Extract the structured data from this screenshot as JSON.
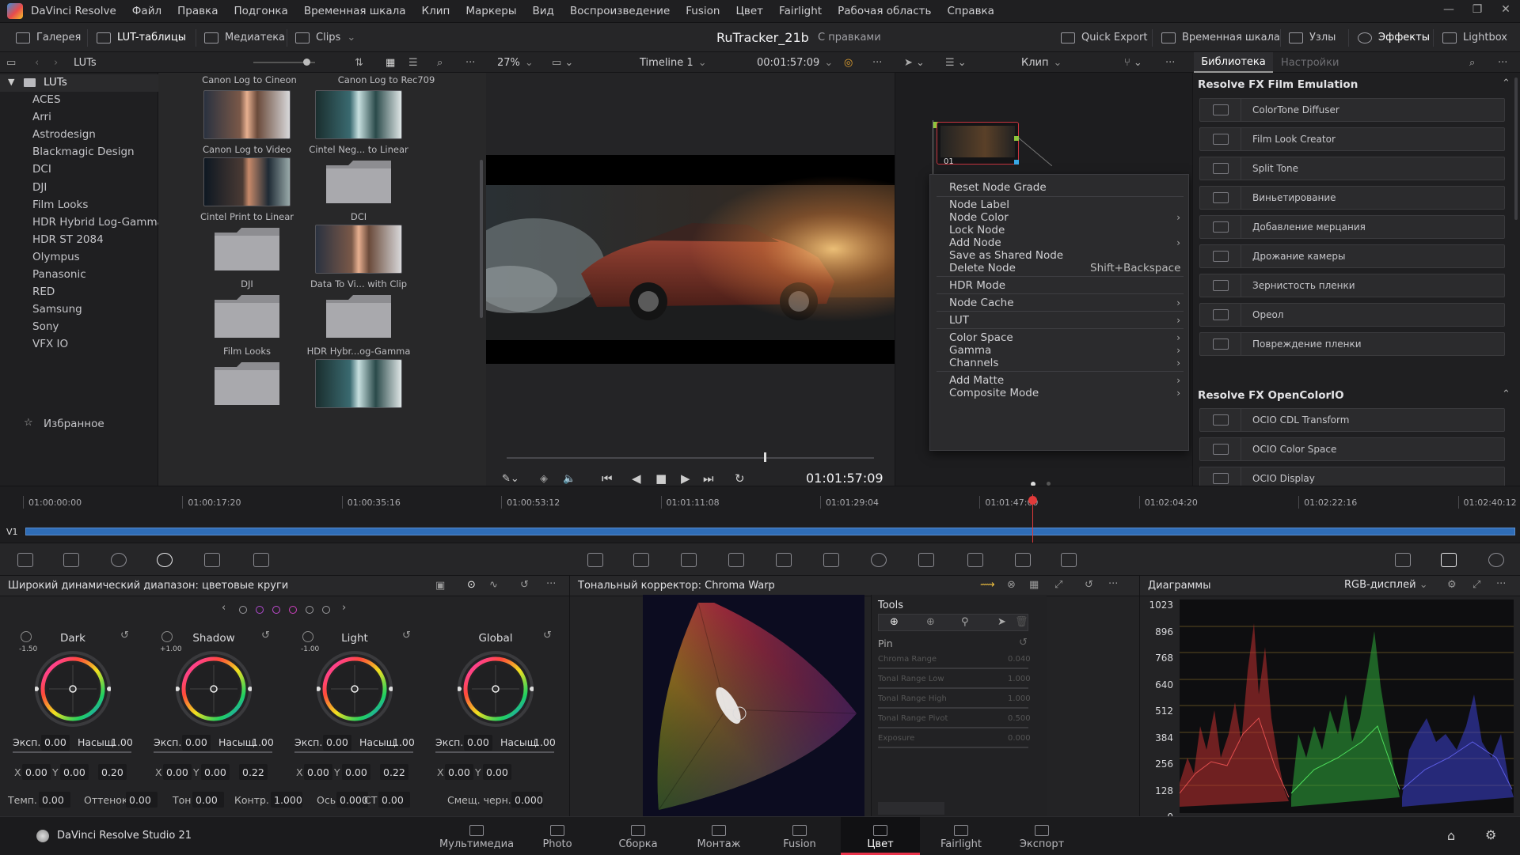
{
  "menubar": {
    "app": "DaVinci Resolve",
    "items": [
      "Файл",
      "Правка",
      "Подгонка",
      "Временная шкала",
      "Клип",
      "Маркеры",
      "Вид",
      "Воспроизведение",
      "Fusion",
      "Цвет",
      "Fairlight",
      "Рабочая область",
      "Справка"
    ]
  },
  "toolbar": {
    "gallery": "Галерея",
    "luts": "LUT-таблицы",
    "media": "Медиатека",
    "clips": "Clips",
    "project": "RuTracker_21b",
    "project_status": "С правками",
    "quick_export": "Quick Export",
    "timeline": "Временная шкала",
    "nodes": "Узлы",
    "effects": "Эффекты",
    "lightbox": "Lightbox"
  },
  "header": {
    "luts_title": "LUTs",
    "zoom": "27%",
    "timeline_name": "Timeline 1",
    "timecode": "00:01:57:09",
    "clip_mode": "Клип",
    "tab_library": "Библиотека",
    "tab_settings": "Настройки"
  },
  "tree": {
    "root": "LUTs",
    "items": [
      "ACES",
      "Arri",
      "Astrodesign",
      "Blackmagic Design",
      "DCI",
      "DJI",
      "Film Looks",
      "HDR Hybrid Log-Gamma",
      "HDR ST 2084",
      "Olympus",
      "Panasonic",
      "RED",
      "Samsung",
      "Sony",
      "VFX IO"
    ],
    "favorites": "Избранное"
  },
  "thumbs": {
    "top_labels": [
      "Canon Log to Cineon",
      "Canon Log to Rec709"
    ],
    "items": [
      {
        "label": "Canon Log to Video",
        "type": "face"
      },
      {
        "label": "Cintel Neg... to Linear",
        "type": "neg"
      },
      {
        "label": "Cintel Print to Linear",
        "type": "dark"
      },
      {
        "label": "DCI",
        "type": "folder"
      },
      {
        "label": "DJI",
        "type": "folder"
      },
      {
        "label": "Data To Vi... with Clip",
        "type": "face"
      },
      {
        "label": "Film Looks",
        "type": "folder"
      },
      {
        "label": "HDR Hybr...og-Gamma",
        "type": "folder"
      },
      {
        "label": "",
        "type": "folder"
      },
      {
        "label": "",
        "type": "neg"
      }
    ]
  },
  "viewer": {
    "timecode": "01:01:57:09",
    "scrub_position": 0.7
  },
  "node": {
    "label": "01"
  },
  "context_menu": {
    "items": [
      {
        "label": "Reset Node Grade"
      },
      {
        "label": "Node Label"
      },
      {
        "label": "Node Color",
        "sub": true
      },
      {
        "label": "Lock Node"
      },
      {
        "label": "Add Node",
        "sub": true
      },
      {
        "label": "Save as Shared Node"
      },
      {
        "label": "Delete Node",
        "shortcut": "Shift+Backspace"
      },
      {
        "label": "HDR Mode"
      },
      {
        "label": "Node Cache",
        "sub": true
      },
      {
        "label": "LUT",
        "sub": true
      },
      {
        "label": "Color Space",
        "sub": true
      },
      {
        "label": "Gamma",
        "sub": true
      },
      {
        "label": "Channels",
        "sub": true
      },
      {
        "label": "Add Matte",
        "sub": true
      },
      {
        "label": "Composite Mode",
        "sub": true
      }
    ]
  },
  "effects": {
    "section1": "Resolve FX Film Emulation",
    "items1": [
      "ColorTone Diffuser",
      "Film Look Creator",
      "Split Tone",
      "Виньетирование",
      "Добавление мерцания",
      "Дрожание камеры",
      "Зернистость пленки",
      "Ореол",
      "Повреждение пленки"
    ],
    "section2": "Resolve FX OpenColorIO",
    "items2": [
      "OCIO CDL Transform",
      "OCIO Color Space",
      "OCIO Display"
    ]
  },
  "timeline": {
    "track": "V1",
    "timecodes": [
      "01:00:00:00",
      "01:00:17:20",
      "01:00:35:16",
      "01:00:53:12",
      "01:01:11:08",
      "01:01:29:04",
      "01:01:47:00",
      "01:02:04:20",
      "01:02:22:16",
      "01:02:40:12"
    ],
    "playhead_position": 0.703
  },
  "wheels": {
    "title": "Широкий динамический диапазон: цветовые круги",
    "wheels": [
      {
        "name": "Dark",
        "exp_label": "Эксп.",
        "exp": "0.00",
        "sat_label": "Насыщ.",
        "sat": "1.00",
        "x": "0.00",
        "y": "0.00",
        "z": "0.20",
        "corner": "-1.50"
      },
      {
        "name": "Shadow",
        "exp_label": "Эксп.",
        "exp": "0.00",
        "sat_label": "Насыщ.",
        "sat": "1.00",
        "x": "0.00",
        "y": "0.00",
        "z": "0.22",
        "corner": "+1.00"
      },
      {
        "name": "Light",
        "exp_label": "Эксп.",
        "exp": "0.00",
        "sat_label": "Насыщ.",
        "sat": "1.00",
        "x": "0.00",
        "y": "0.00",
        "z": "0.22",
        "corner": "-1.00"
      },
      {
        "name": "Global",
        "exp_label": "Эксп.",
        "exp": "0.00",
        "sat_label": "Насыщ.",
        "sat": "1.00",
        "x": "0.00",
        "y": "0.00",
        "z": "",
        "corner": ""
      }
    ],
    "bottom": [
      {
        "label": "Темп.",
        "value": "0.00"
      },
      {
        "label": "Оттенок",
        "value": "0.00"
      },
      {
        "label": "Тон",
        "value": "0.00"
      },
      {
        "label": "Контр.",
        "value": "1.000"
      },
      {
        "label": "Ось",
        "value": "0.000"
      },
      {
        "label": "СТ",
        "value": "0.00"
      },
      {
        "label": "Смещ. черн.",
        "value": "0.000"
      }
    ]
  },
  "chroma": {
    "title": "Тональный корректор: Chroma Warp",
    "tools": "Tools",
    "pin": "Pin",
    "params": [
      {
        "label": "Chroma Range",
        "value": "0.040"
      },
      {
        "label": "Tonal Range Low",
        "value": "1.000"
      },
      {
        "label": "Tonal Range High",
        "value": "1.000"
      },
      {
        "label": "Tonal Range Pivot",
        "value": "0.500"
      },
      {
        "label": "Exposure",
        "value": "0.000"
      }
    ]
  },
  "scopes": {
    "title": "Диаграммы",
    "mode": "RGB-дисплей",
    "axis": [
      "1023",
      "896",
      "768",
      "640",
      "512",
      "384",
      "256",
      "128",
      "0"
    ]
  },
  "nav": {
    "brand": "DaVinci Resolve Studio 21",
    "items": [
      "Мультимедиа",
      "Photo",
      "Сборка",
      "Монтаж",
      "Fusion",
      "Цвет",
      "Fairlight",
      "Экспорт"
    ],
    "active": 5
  }
}
